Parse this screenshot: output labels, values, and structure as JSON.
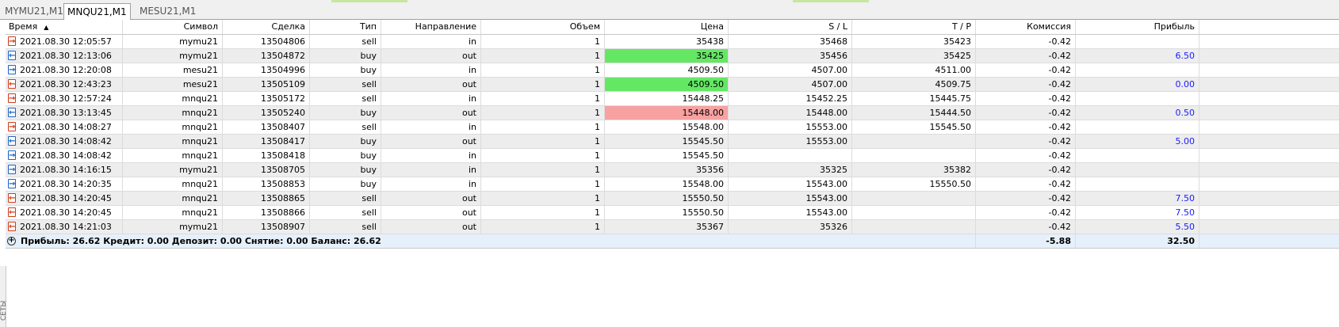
{
  "tabs": [
    {
      "label": "MYMU21,M1",
      "active": false
    },
    {
      "label": "MNQU21,M1",
      "active": true
    },
    {
      "label": "MESU21,M1",
      "active": false
    }
  ],
  "sidebar_label": "СЕТЫ",
  "columns": {
    "time": "Время",
    "symbol": "Символ",
    "deal": "Сделка",
    "type": "Тип",
    "direction": "Направление",
    "volume": "Объем",
    "price": "Цена",
    "sl": "S / L",
    "tp": "T / P",
    "commission": "Комиссия",
    "profit": "Прибыль"
  },
  "sort_indicator": "▲",
  "colors": {
    "highlight_green": "#64e864",
    "highlight_red": "#f7a1a1",
    "profit_text": "#1a1aff",
    "summary_bg": "#e6f0fa",
    "alt_row": "#ededed"
  },
  "deals": [
    {
      "time": "2021.08.30 12:05:57",
      "symbol": "mymu21",
      "deal": "13504806",
      "type": "sell",
      "direction": "in",
      "volume": "1",
      "price": "35438",
      "sl": "35468",
      "tp": "35423",
      "commission": "-0.42",
      "profit": "",
      "highlight": ""
    },
    {
      "time": "2021.08.30 12:13:06",
      "symbol": "mymu21",
      "deal": "13504872",
      "type": "buy",
      "direction": "out",
      "volume": "1",
      "price": "35425",
      "sl": "35456",
      "tp": "35425",
      "commission": "-0.42",
      "profit": "6.50",
      "highlight": "green"
    },
    {
      "time": "2021.08.30 12:20:08",
      "symbol": "mesu21",
      "deal": "13504996",
      "type": "buy",
      "direction": "in",
      "volume": "1",
      "price": "4509.50",
      "sl": "4507.00",
      "tp": "4511.00",
      "commission": "-0.42",
      "profit": "",
      "highlight": ""
    },
    {
      "time": "2021.08.30 12:43:23",
      "symbol": "mesu21",
      "deal": "13505109",
      "type": "sell",
      "direction": "out",
      "volume": "1",
      "price": "4509.50",
      "sl": "4507.00",
      "tp": "4509.75",
      "commission": "-0.42",
      "profit": "0.00",
      "highlight": "green"
    },
    {
      "time": "2021.08.30 12:57:24",
      "symbol": "mnqu21",
      "deal": "13505172",
      "type": "sell",
      "direction": "in",
      "volume": "1",
      "price": "15448.25",
      "sl": "15452.25",
      "tp": "15445.75",
      "commission": "-0.42",
      "profit": "",
      "highlight": ""
    },
    {
      "time": "2021.08.30 13:13:45",
      "symbol": "mnqu21",
      "deal": "13505240",
      "type": "buy",
      "direction": "out",
      "volume": "1",
      "price": "15448.00",
      "sl": "15448.00",
      "tp": "15444.50",
      "commission": "-0.42",
      "profit": "0.50",
      "highlight": "red"
    },
    {
      "time": "2021.08.30 14:08:27",
      "symbol": "mnqu21",
      "deal": "13508407",
      "type": "sell",
      "direction": "in",
      "volume": "1",
      "price": "15548.00",
      "sl": "15553.00",
      "tp": "15545.50",
      "commission": "-0.42",
      "profit": "",
      "highlight": ""
    },
    {
      "time": "2021.08.30 14:08:42",
      "symbol": "mnqu21",
      "deal": "13508417",
      "type": "buy",
      "direction": "out",
      "volume": "1",
      "price": "15545.50",
      "sl": "15553.00",
      "tp": "",
      "commission": "-0.42",
      "profit": "5.00",
      "highlight": ""
    },
    {
      "time": "2021.08.30 14:08:42",
      "symbol": "mnqu21",
      "deal": "13508418",
      "type": "buy",
      "direction": "in",
      "volume": "1",
      "price": "15545.50",
      "sl": "",
      "tp": "",
      "commission": "-0.42",
      "profit": "",
      "highlight": ""
    },
    {
      "time": "2021.08.30 14:16:15",
      "symbol": "mymu21",
      "deal": "13508705",
      "type": "buy",
      "direction": "in",
      "volume": "1",
      "price": "35356",
      "sl": "35325",
      "tp": "35382",
      "commission": "-0.42",
      "profit": "",
      "highlight": ""
    },
    {
      "time": "2021.08.30 14:20:35",
      "symbol": "mnqu21",
      "deal": "13508853",
      "type": "buy",
      "direction": "in",
      "volume": "1",
      "price": "15548.00",
      "sl": "15543.00",
      "tp": "15550.50",
      "commission": "-0.42",
      "profit": "",
      "highlight": ""
    },
    {
      "time": "2021.08.30 14:20:45",
      "symbol": "mnqu21",
      "deal": "13508865",
      "type": "sell",
      "direction": "out",
      "volume": "1",
      "price": "15550.50",
      "sl": "15543.00",
      "tp": "",
      "commission": "-0.42",
      "profit": "7.50",
      "highlight": ""
    },
    {
      "time": "2021.08.30 14:20:45",
      "symbol": "mnqu21",
      "deal": "13508866",
      "type": "sell",
      "direction": "out",
      "volume": "1",
      "price": "15550.50",
      "sl": "15543.00",
      "tp": "",
      "commission": "-0.42",
      "profit": "7.50",
      "highlight": ""
    },
    {
      "time": "2021.08.30 14:21:03",
      "symbol": "mymu21",
      "deal": "13508907",
      "type": "sell",
      "direction": "out",
      "volume": "1",
      "price": "35367",
      "sl": "35326",
      "tp": "",
      "commission": "-0.42",
      "profit": "5.50",
      "highlight": ""
    }
  ],
  "summary": {
    "text": "Прибыль: 26.62  Кредит: 0.00  Депозит: 0.00  Снятие: 0.00  Баланс: 26.62",
    "commission_total": "-5.88",
    "profit_total": "32.50"
  }
}
